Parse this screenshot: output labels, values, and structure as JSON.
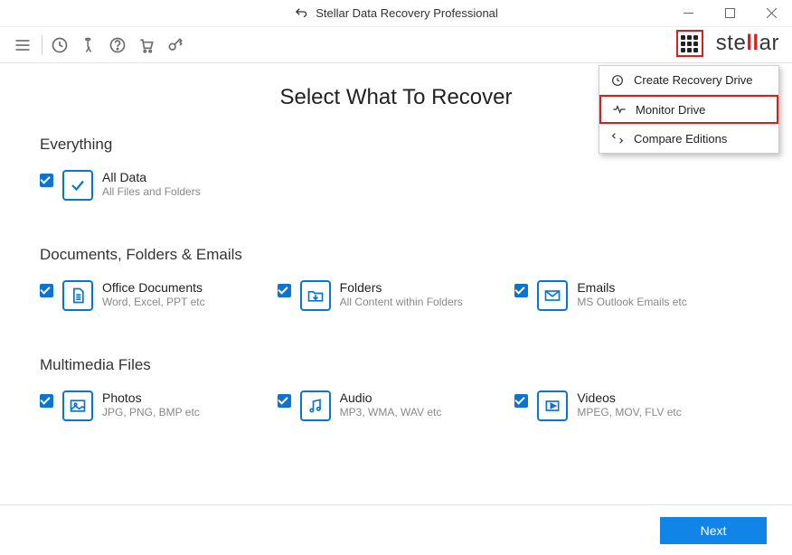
{
  "title": "Stellar Data Recovery Professional",
  "brand_prefix": "ste",
  "brand_mid": "ll",
  "brand_suffix": "ar",
  "page_heading": "Select What To Recover",
  "dropdown": {
    "items": [
      {
        "label": "Create Recovery Drive"
      },
      {
        "label": "Monitor Drive"
      },
      {
        "label": "Compare Editions"
      }
    ]
  },
  "sections": {
    "everything": {
      "title": "Everything",
      "item": {
        "label": "All Data",
        "sub": "All Files and Folders"
      }
    },
    "documents": {
      "title": "Documents, Folders & Emails",
      "items": [
        {
          "label": "Office Documents",
          "sub": "Word, Excel, PPT etc"
        },
        {
          "label": "Folders",
          "sub": "All Content within Folders"
        },
        {
          "label": "Emails",
          "sub": "MS Outlook Emails etc"
        }
      ]
    },
    "multimedia": {
      "title": "Multimedia Files",
      "items": [
        {
          "label": "Photos",
          "sub": "JPG, PNG, BMP etc"
        },
        {
          "label": "Audio",
          "sub": "MP3, WMA, WAV etc"
        },
        {
          "label": "Videos",
          "sub": "MPEG, MOV, FLV etc"
        }
      ]
    }
  },
  "footer": {
    "next": "Next"
  }
}
